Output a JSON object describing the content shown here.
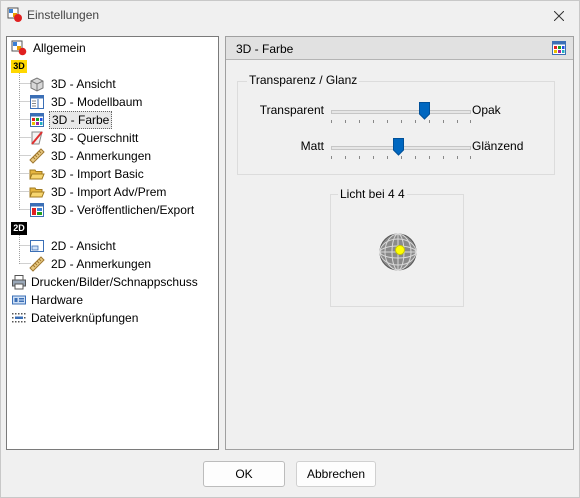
{
  "window": {
    "title": "Einstellungen"
  },
  "tree": {
    "items": [
      {
        "label": "Allgemein",
        "icon": "settings-icon"
      },
      {
        "label": "3D",
        "icon": "3d-badge-icon"
      },
      {
        "label": "3D - Ansicht",
        "icon": "cube-icon"
      },
      {
        "label": "3D - Modellbaum",
        "icon": "tree-panel-icon"
      },
      {
        "label": "3D - Farbe",
        "icon": "color-palette-icon",
        "selected": true
      },
      {
        "label": "3D - Querschnitt",
        "icon": "cross-section-icon"
      },
      {
        "label": "3D - Anmerkungen",
        "icon": "ruler-icon"
      },
      {
        "label": "3D - Import Basic",
        "icon": "folder-open-icon"
      },
      {
        "label": "3D - Import Adv/Prem",
        "icon": "folder-open-icon"
      },
      {
        "label": "3D - Veröffentlichen/Export",
        "icon": "export-icon"
      },
      {
        "label": "2D",
        "icon": "2d-badge-icon"
      },
      {
        "label": "2D - Ansicht",
        "icon": "window-icon"
      },
      {
        "label": "2D - Anmerkungen",
        "icon": "ruler-icon"
      },
      {
        "label": "Drucken/Bilder/Schnappschuss",
        "icon": "printer-icon"
      },
      {
        "label": "Hardware",
        "icon": "hardware-icon"
      },
      {
        "label": "Dateiverknüpfungen",
        "icon": "file-association-icon"
      }
    ]
  },
  "panel": {
    "title": "3D - Farbe",
    "group_title": "Transparenz / Glanz",
    "sliders": [
      {
        "left_label": "Transparent",
        "right_label": "Opak",
        "value": 0.67
      },
      {
        "left_label": "Matt",
        "right_label": "Glänzend",
        "value": 0.48
      }
    ],
    "light": {
      "title": "Licht bei 4 4"
    }
  },
  "buttons": {
    "ok": "OK",
    "cancel": "Abbrechen"
  },
  "colors": {
    "accent": "#0067c0",
    "light_dot": "#ffff00",
    "badge_3d": "#ffd800"
  }
}
